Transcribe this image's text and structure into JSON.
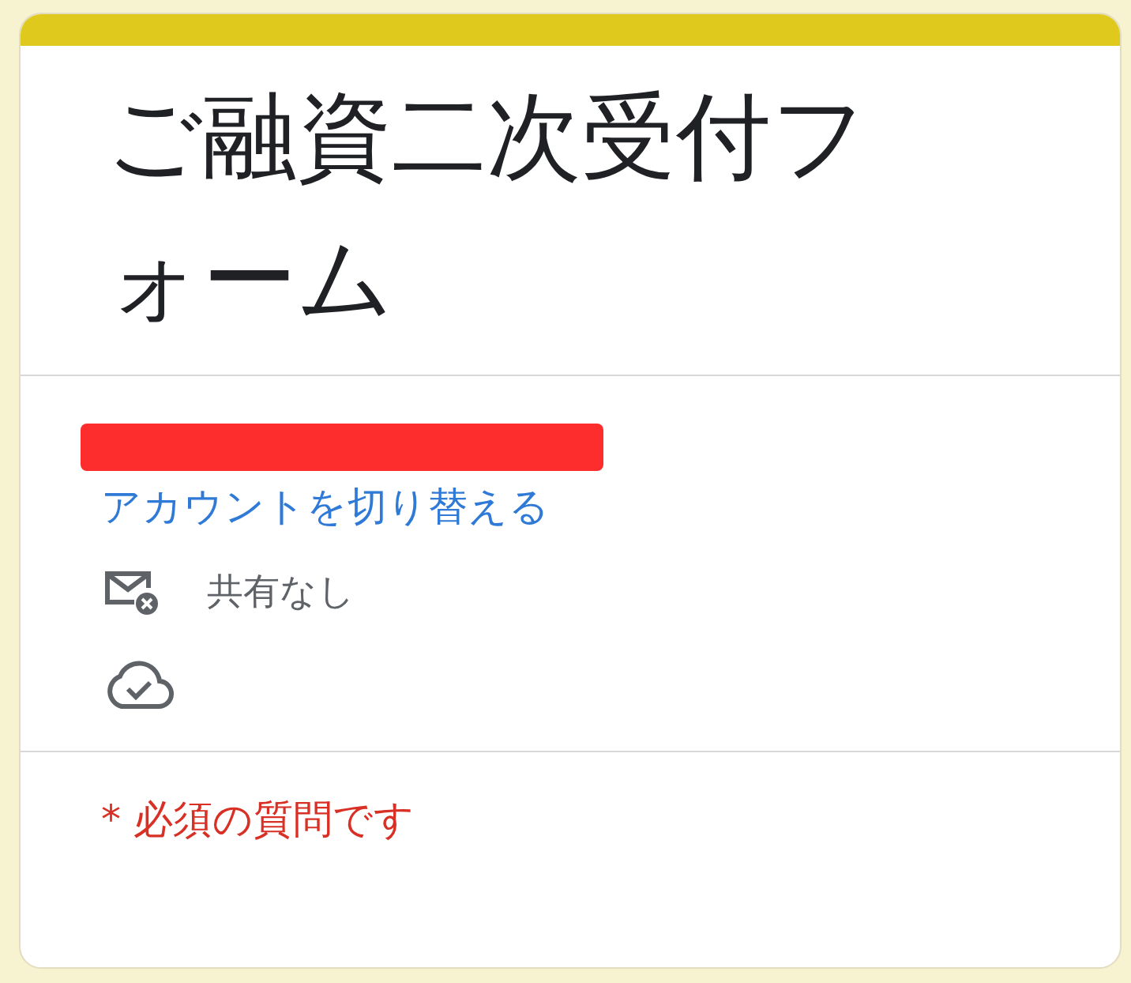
{
  "form": {
    "title": "ご融資二次受付フォーム",
    "switch_account": "アカウントを切り替える",
    "sharing": "共有なし",
    "required_note": "* 必須の質問です"
  }
}
